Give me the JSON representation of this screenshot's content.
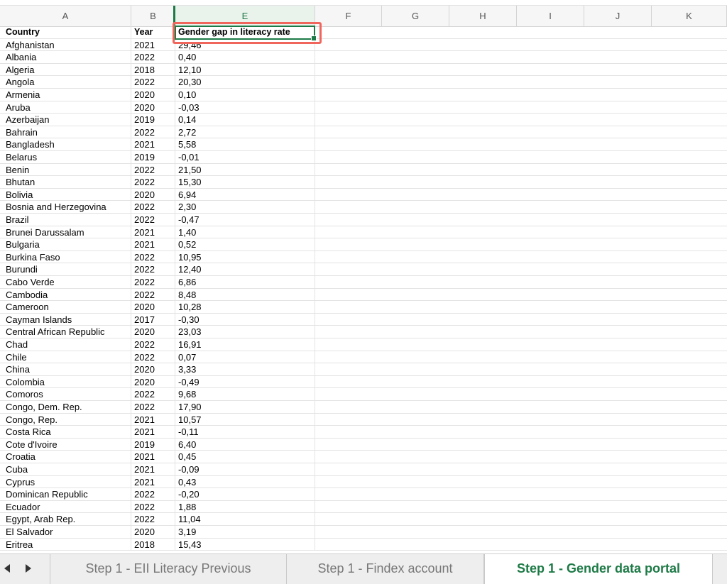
{
  "columns": [
    "A",
    "B",
    "E",
    "F",
    "G",
    "H",
    "I",
    "J",
    "K"
  ],
  "header": {
    "country": "Country",
    "year": "Year",
    "gap": "Gender gap in literacy rate"
  },
  "rows": [
    [
      "Afghanistan",
      "2021",
      "29,46"
    ],
    [
      "Albania",
      "2022",
      "0,40"
    ],
    [
      "Algeria",
      "2018",
      "12,10"
    ],
    [
      "Angola",
      "2022",
      "20,30"
    ],
    [
      "Armenia",
      "2020",
      "0,10"
    ],
    [
      "Aruba",
      "2020",
      "-0,03"
    ],
    [
      "Azerbaijan",
      "2019",
      "0,14"
    ],
    [
      "Bahrain",
      "2022",
      "2,72"
    ],
    [
      "Bangladesh",
      "2021",
      "5,58"
    ],
    [
      "Belarus",
      "2019",
      "-0,01"
    ],
    [
      "Benin",
      "2022",
      "21,50"
    ],
    [
      "Bhutan",
      "2022",
      "15,30"
    ],
    [
      "Bolivia",
      "2020",
      "6,94"
    ],
    [
      "Bosnia and Herzegovina",
      "2022",
      "2,30"
    ],
    [
      "Brazil",
      "2022",
      "-0,47"
    ],
    [
      "Brunei Darussalam",
      "2021",
      "1,40"
    ],
    [
      "Bulgaria",
      "2021",
      "0,52"
    ],
    [
      "Burkina Faso",
      "2022",
      "10,95"
    ],
    [
      "Burundi",
      "2022",
      "12,40"
    ],
    [
      "Cabo Verde",
      "2022",
      "6,86"
    ],
    [
      "Cambodia",
      "2022",
      "8,48"
    ],
    [
      "Cameroon",
      "2020",
      "10,28"
    ],
    [
      "Cayman Islands",
      "2017",
      "-0,30"
    ],
    [
      "Central African Republic",
      "2020",
      "23,03"
    ],
    [
      "Chad",
      "2022",
      "16,91"
    ],
    [
      "Chile",
      "2022",
      "0,07"
    ],
    [
      "China",
      "2020",
      "3,33"
    ],
    [
      "Colombia",
      "2020",
      "-0,49"
    ],
    [
      "Comoros",
      "2022",
      "9,68"
    ],
    [
      "Congo, Dem. Rep.",
      "2022",
      "17,90"
    ],
    [
      "Congo, Rep.",
      "2021",
      "10,57"
    ],
    [
      "Costa Rica",
      "2021",
      "-0,11"
    ],
    [
      "Cote d'Ivoire",
      "2019",
      "6,40"
    ],
    [
      "Croatia",
      "2021",
      "0,45"
    ],
    [
      "Cuba",
      "2021",
      "-0,09"
    ],
    [
      "Cyprus",
      "2021",
      "0,43"
    ],
    [
      "Dominican Republic",
      "2022",
      "-0,20"
    ],
    [
      "Ecuador",
      "2022",
      "1,88"
    ],
    [
      "Egypt, Arab Rep.",
      "2022",
      "11,04"
    ],
    [
      "El Salvador",
      "2020",
      "3,19"
    ],
    [
      "Eritrea",
      "2018",
      "15,43"
    ]
  ],
  "tabs": [
    "Step 1 - EII Literacy Previous",
    "Step 1 - Findex account",
    "Step 1 - Gender data portal"
  ],
  "active_tab": "Step 1 - Gender data portal",
  "colors": {
    "accent": "#1d7a46",
    "highlight": "#f0665c"
  },
  "icons": [
    "arrow-left-icon",
    "arrow-right-icon"
  ]
}
